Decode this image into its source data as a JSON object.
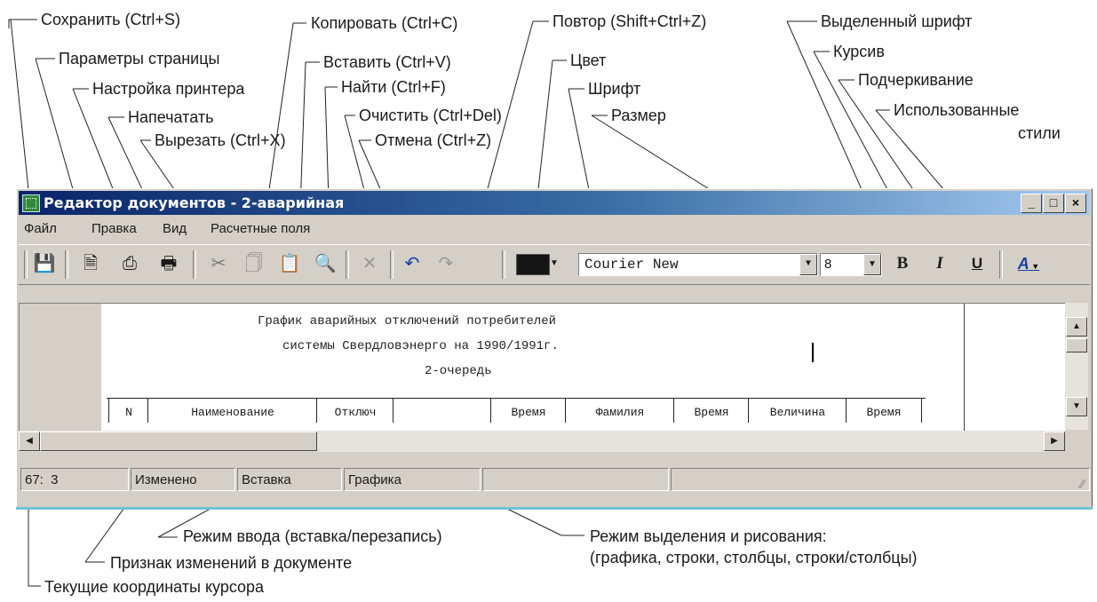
{
  "window": {
    "title": "Редактор документов - 2-аварийная",
    "minimize": "_",
    "maximize": "□",
    "close": "×"
  },
  "menu": [
    "Файл",
    "Правка",
    "Вид",
    "Расчетные поля"
  ],
  "toolbar": {
    "font_name": "Courier New",
    "font_size": "8",
    "bold": "B",
    "italic": "I",
    "underline": "U",
    "styles": "A"
  },
  "document": {
    "line1": "График аварийных отключений потребителей",
    "line2": "системы Свердловэнерго на 1990/1991г.",
    "line3": "2-очередь",
    "table_headers": [
      "N",
      "Наименование",
      "Отключ",
      "",
      "Время",
      "Фамилия",
      "Время",
      "Величина",
      "Время"
    ]
  },
  "status": {
    "coords": "67:  3",
    "modified": "Изменено",
    "insert": "Вставка",
    "mode": "Графика"
  },
  "callouts": {
    "save": "Сохранить (Ctrl+S)",
    "page_params": "Параметры страницы",
    "printer_setup": "Настройка принтера",
    "print": "Напечатать",
    "cut": "Вырезать (Ctrl+X)",
    "copy": "Копировать (Ctrl+C)",
    "paste": "Вставить (Ctrl+V)",
    "find": "Найти (Ctrl+F)",
    "clear": "Очистить (Ctrl+Del)",
    "undo": "Отмена (Ctrl+Z)",
    "redo": "Повтор (Shift+Ctrl+Z)",
    "color": "Цвет",
    "font": "Шрифт",
    "size": "Размер",
    "selected_font": "Выделенный шрифт",
    "italic": "Курсив",
    "underline": "Подчеркивание",
    "used_styles_1": "Использованные",
    "used_styles_2": "стили",
    "input_mode": "Режим ввода (вставка/перезапись)",
    "selection_mode_1": "Режим выделения и рисования:",
    "selection_mode_2": "(графика, строки, столбцы, строки/столбцы)",
    "change_flag": "Признак изменений в документе",
    "cursor_coords": "Текущие координаты курсора"
  }
}
